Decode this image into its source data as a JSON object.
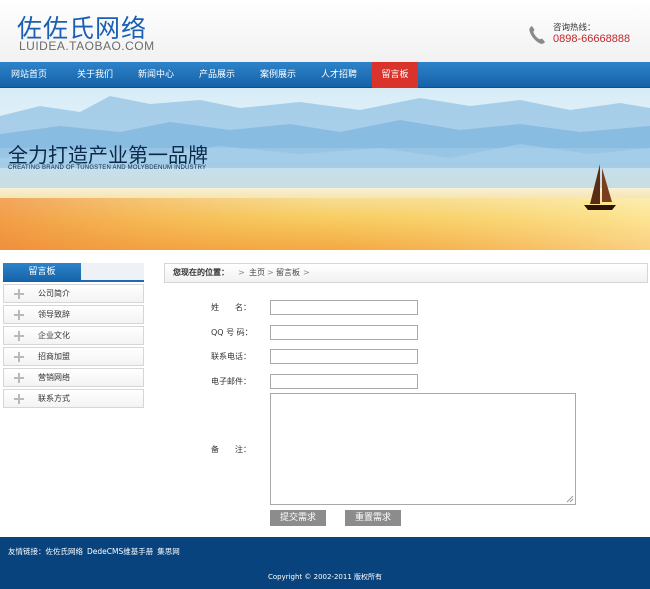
{
  "header": {
    "logo_cn": "佐佐氏网络",
    "logo_en": "LUIDEA.TAOBAO.COM",
    "hotline_label": "咨询热线：",
    "hotline_number": "0898-66668888"
  },
  "nav": {
    "items": [
      "网站首页",
      "关于我们",
      "新闻中心",
      "产品展示",
      "案例展示",
      "人才招聘",
      "留言板"
    ],
    "active_index": 6
  },
  "banner": {
    "title": "全力打造产业第一品牌",
    "subtitle": "CREATING BRAND OF TUNGSTEN AND MOLYBDENUM INDUSTRY"
  },
  "sidebar": {
    "title": "留言板",
    "items": [
      "公司简介",
      "领导致辞",
      "企业文化",
      "招商加盟",
      "营销网络",
      "联系方式"
    ]
  },
  "breadcrumb": {
    "lead": "您现在的位置：",
    "items": [
      "主页",
      "留言板"
    ],
    "separator": ">"
  },
  "form": {
    "name_label": "姓　　名：",
    "qq_label": "QQ 号 码：",
    "phone_label": "联系电话：",
    "email_label": "电子邮件：",
    "notes_label": "备　　注：",
    "submit_label": "提交需求",
    "reset_label": "重置需求"
  },
  "footer": {
    "links_label": "友情链接：",
    "links": [
      "佐佐氏网络",
      "DedeCMS维基手册",
      "集思网"
    ],
    "copyright": "Copyright © 2002-2011 版权所有"
  },
  "colors": {
    "nav_blue": "#1a6bb3",
    "active_red": "#d9332b",
    "footer_blue": "#08437e",
    "hotline_red": "#c0282d"
  }
}
